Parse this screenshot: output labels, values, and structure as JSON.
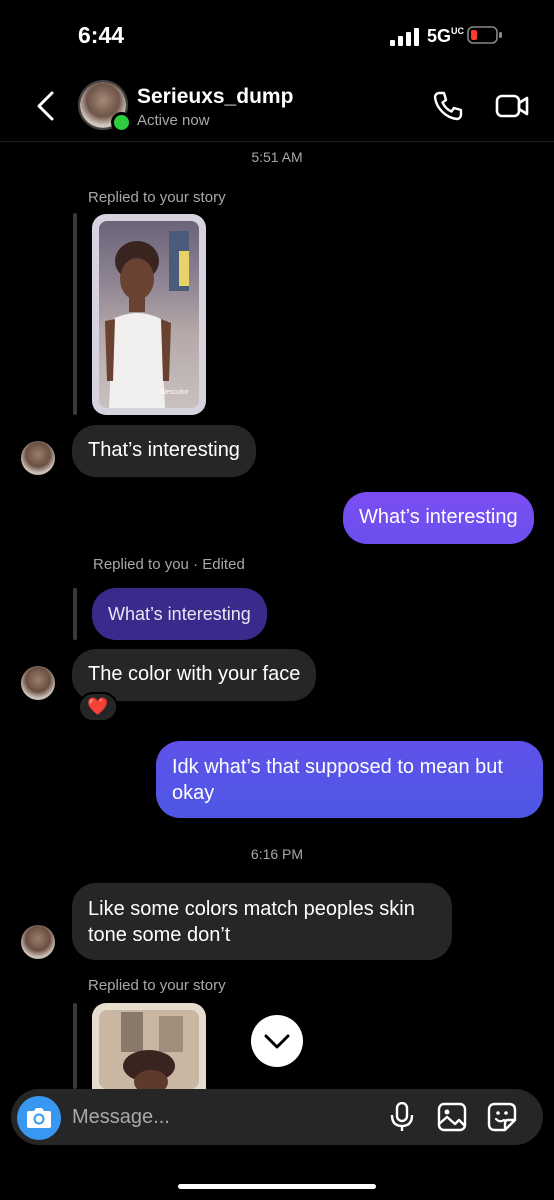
{
  "status_bar": {
    "time": "6:44",
    "network": "5G",
    "network_sup": "UC"
  },
  "header": {
    "username": "Serieuxs_dump",
    "status": "Active now"
  },
  "messages": {
    "ts1": "5:51 AM",
    "story_reply_1_label": "Replied to your story",
    "story_overlay_text": "Nescolor",
    "msg1": "That’s interesting",
    "msg2_out": "What’s interesting",
    "reply_label": "Replied to you",
    "edited_label": "Edited",
    "quoted": "What’s interesting",
    "msg3": "The color with your face",
    "reaction": "❤️",
    "msg4_out": "Idk what’s that supposed to mean but okay",
    "ts2": "6:16 PM",
    "msg5": "Like some colors match peoples skin tone some don’t",
    "story_reply_2_label": "Replied to your story"
  },
  "composer": {
    "placeholder": "Message..."
  },
  "colors": {
    "outgoing_top": "#7b4ef2",
    "outgoing_bottom": "#4f55e6",
    "quoted_bg": "#3a2a8c",
    "accent": "#3897f0"
  }
}
